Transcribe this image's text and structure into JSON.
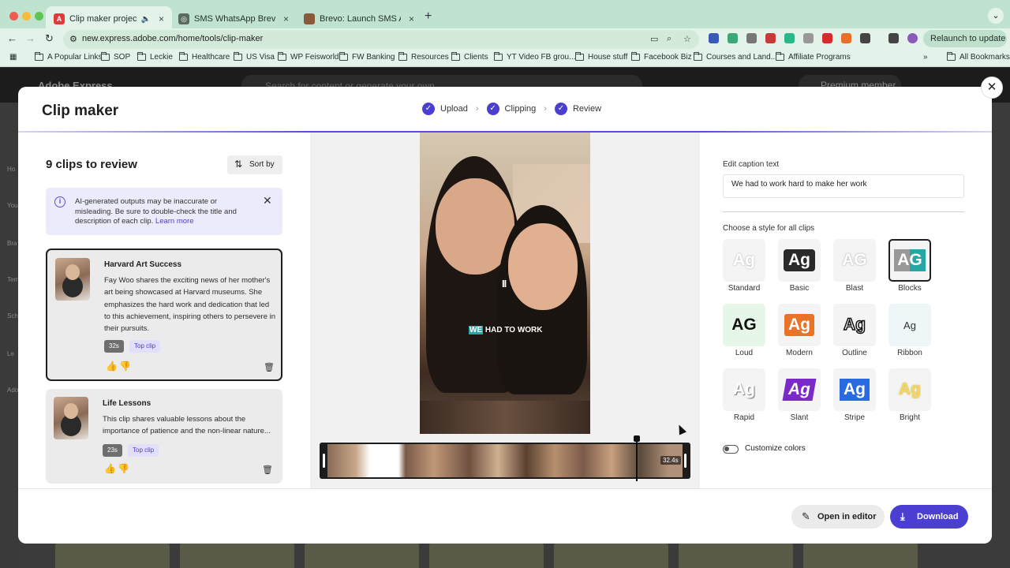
{
  "browser": {
    "tabs": [
      {
        "label": "Clip maker project - April",
        "fav_color": "#e03a3a"
      },
      {
        "label": "SMS WhatsApp Brevo Strateg",
        "fav_color": "#5a6a60"
      },
      {
        "label": "Brevo: Launch SMS And Wha",
        "fav_color": "#8a5a3a"
      }
    ],
    "url": "new.express.adobe.com/home/tools/clip-maker",
    "relaunch_label": "Relaunch to update",
    "bookmarks": [
      "A Popular Links",
      "SOP",
      "Leckie",
      "Healthcare",
      "US Visa",
      "WP Feisworld",
      "FW Banking",
      "Resources",
      "Clients",
      "YT Video FB grou...",
      "House stuff",
      "Facebook Biz",
      "Courses and Land...",
      "Affiliate Programs"
    ],
    "all_bookmarks": "All Bookmarks"
  },
  "app": {
    "brand": "Adobe Express",
    "search_placeholder": "Search for content or generate your own",
    "premium": "Premium member",
    "rail_labels": [
      "Ho",
      "You",
      "Bra",
      "Tem",
      "Sch",
      "Le",
      "Ado"
    ]
  },
  "modal": {
    "title": "Clip maker",
    "steps": [
      "Upload",
      "Clipping",
      "Review"
    ],
    "clips_title": "9 clips to review",
    "sort_label": "Sort by",
    "notice": {
      "text": "AI-generated outputs may be inaccurate or misleading. Be sure to double-check the title and description of each clip.",
      "link": "Learn more"
    },
    "clips": [
      {
        "title": "Harvard Art Success",
        "description": "Fay Woo shares the exciting news of her mother's art being showcased at Harvard museums. She emphasizes the hard work and dedication that led to this achievement, inspiring others to persevere in their pursuits.",
        "duration": "32s",
        "badge": "Top clip"
      },
      {
        "title": "Life Lessons",
        "description": "This clip shares valuable lessons about the importance of patience and the non-linear nature...",
        "duration": "23s",
        "badge": "Top clip"
      }
    ],
    "video": {
      "caption_highlight": "WE",
      "caption_rest": " HAD TO WORK",
      "pause_glyph": "II",
      "timeline_duration": "32.4s"
    },
    "edit_caption_label": "Edit caption text",
    "caption_text": "We had to work hard to make her work",
    "style_label": "Choose a style for all clips",
    "styles": [
      {
        "name": "Standard"
      },
      {
        "name": "Basic"
      },
      {
        "name": "Blast"
      },
      {
        "name": "Blocks"
      },
      {
        "name": "Loud"
      },
      {
        "name": "Modern"
      },
      {
        "name": "Outline"
      },
      {
        "name": "Ribbon"
      },
      {
        "name": "Rapid"
      },
      {
        "name": "Slant"
      },
      {
        "name": "Stripe"
      },
      {
        "name": "Bright"
      }
    ],
    "selected_style": "Blocks",
    "customize_colors": "Customize colors",
    "open_in_editor": "Open in editor",
    "download": "Download",
    "accent_color": "#4b3fd1"
  }
}
